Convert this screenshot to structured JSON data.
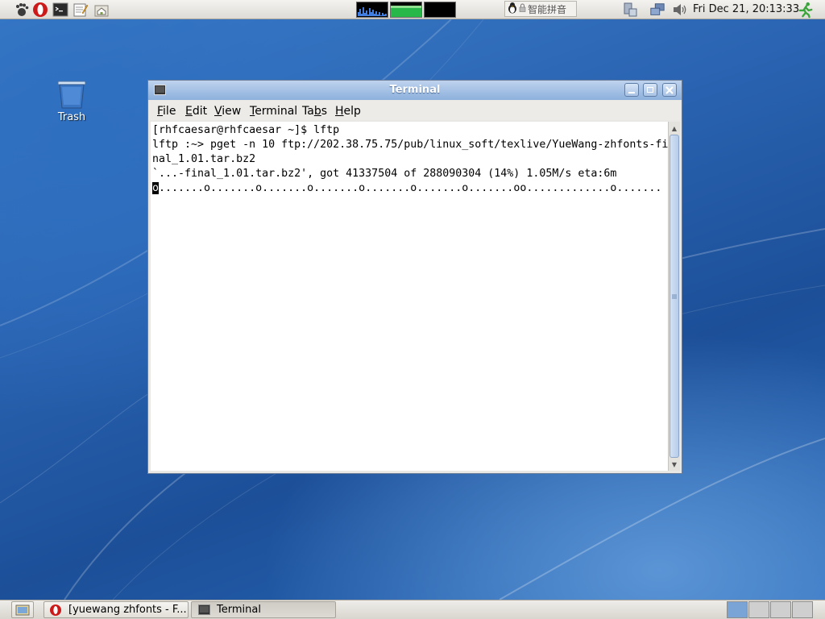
{
  "top_panel": {
    "launchers": [
      {
        "name": "foot-menu-icon"
      },
      {
        "name": "opera-browser-icon"
      },
      {
        "name": "terminal-launcher-icon"
      },
      {
        "name": "text-editor-icon"
      },
      {
        "name": "home-folder-icon"
      }
    ],
    "input_method": {
      "label": "智能拼音"
    },
    "clock": "Fri Dec 21, 20:13:33"
  },
  "desktop": {
    "trash_label": "Trash"
  },
  "window": {
    "title": "Terminal",
    "menu": {
      "file": {
        "u": "F",
        "rest": "ile"
      },
      "edit": {
        "u": "E",
        "rest": "dit"
      },
      "view": {
        "u": "V",
        "rest": "iew"
      },
      "terminal": {
        "u": "T",
        "rest": "erminal"
      },
      "tabs": {
        "pre": "Ta",
        "u": "b",
        "rest": "s"
      },
      "help": {
        "u": "H",
        "rest": "elp"
      }
    },
    "terminal_lines": [
      "[rhfcaesar@rhfcaesar ~]$ lftp",
      "lftp :~> pget -n 10 ftp://202.38.75.75/pub/linux_soft/texlive/YueWang-zhfonts-fi",
      "nal_1.01.tar.bz2",
      "`...-final_1.01.tar.bz2', got 41337504 of 288090304 (14%) 1.05M/s eta:6m"
    ],
    "progress_line": {
      "cursor_char": "o",
      "rest": ".......o.......o.......o.......o.......o.......o.......oo.............o......."
    }
  },
  "taskbar": {
    "tasks": [
      {
        "label": "[yuewang zhfonts - F..."
      },
      {
        "label": "Terminal"
      }
    ]
  },
  "colors": {
    "titlebar_accent": "#8cb0dc",
    "desktop_blue": "#2a64b2"
  }
}
